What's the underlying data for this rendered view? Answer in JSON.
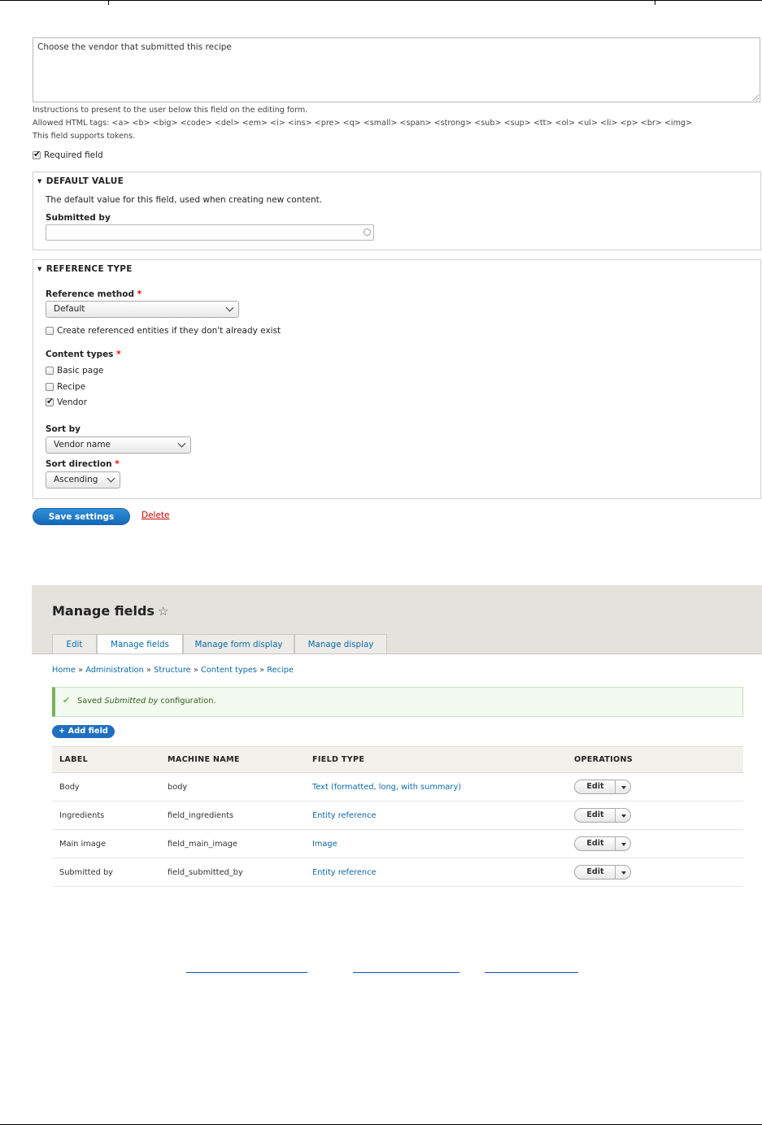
{
  "form": {
    "help_text_value": "Choose the vendor that submitted this recipe",
    "help_desc_1": "Instructions to present to the user below this field on the editing form.",
    "help_desc_2": "Allowed HTML tags: <a> <b> <big> <code> <del> <em> <i> <ins> <pre> <q> <small> <span> <strong> <sub> <sup> <tt> <ol> <ul> <li> <p> <br> <img>",
    "help_desc_3": "This field supports tokens.",
    "required_label": "Required field",
    "required_checked": true,
    "default_value": {
      "legend": "DEFAULT VALUE",
      "description": "The default value for this field, used when creating new content.",
      "submitted_by_label": "Submitted by",
      "submitted_by_value": ""
    },
    "reference_type": {
      "legend": "REFERENCE TYPE",
      "method_label": "Reference method",
      "method_value": "Default",
      "create_label": "Create referenced entities if they don't already exist",
      "content_types_label": "Content types",
      "content_types": [
        {
          "label": "Basic page",
          "checked": false
        },
        {
          "label": "Recipe",
          "checked": false
        },
        {
          "label": "Vendor",
          "checked": true
        }
      ],
      "sort_by_label": "Sort by",
      "sort_by_value": "Vendor name",
      "sort_dir_label": "Sort direction",
      "sort_dir_value": "Ascending"
    },
    "required_marker": "*",
    "save_label": "Save settings",
    "delete_label": "Delete"
  },
  "manage": {
    "title": "Manage fields",
    "star": "☆",
    "tabs": [
      "Edit",
      "Manage fields",
      "Manage form display",
      "Manage display"
    ],
    "active_tab": "Manage fields",
    "breadcrumb": [
      "Home",
      "Administration",
      "Structure",
      "Content types",
      "Recipe"
    ],
    "breadcrumb_sep": "»",
    "message_prefix": "Saved ",
    "message_em": "Submitted by",
    "message_suffix": " configuration.",
    "add_field_label": "+ Add field",
    "columns": [
      "LABEL",
      "MACHINE NAME",
      "FIELD TYPE",
      "OPERATIONS"
    ],
    "rows": [
      {
        "label": "Body",
        "machine": "body",
        "type": "Text (formatted, long, with summary)",
        "op": "Edit"
      },
      {
        "label": "Ingredients",
        "machine": "field_ingredients",
        "type": "Entity reference",
        "op": "Edit"
      },
      {
        "label": "Main image",
        "machine": "field_main_image",
        "type": "Image",
        "op": "Edit"
      },
      {
        "label": "Submitted by",
        "machine": "field_submitted_by",
        "type": "Entity reference",
        "op": "Edit"
      }
    ]
  }
}
